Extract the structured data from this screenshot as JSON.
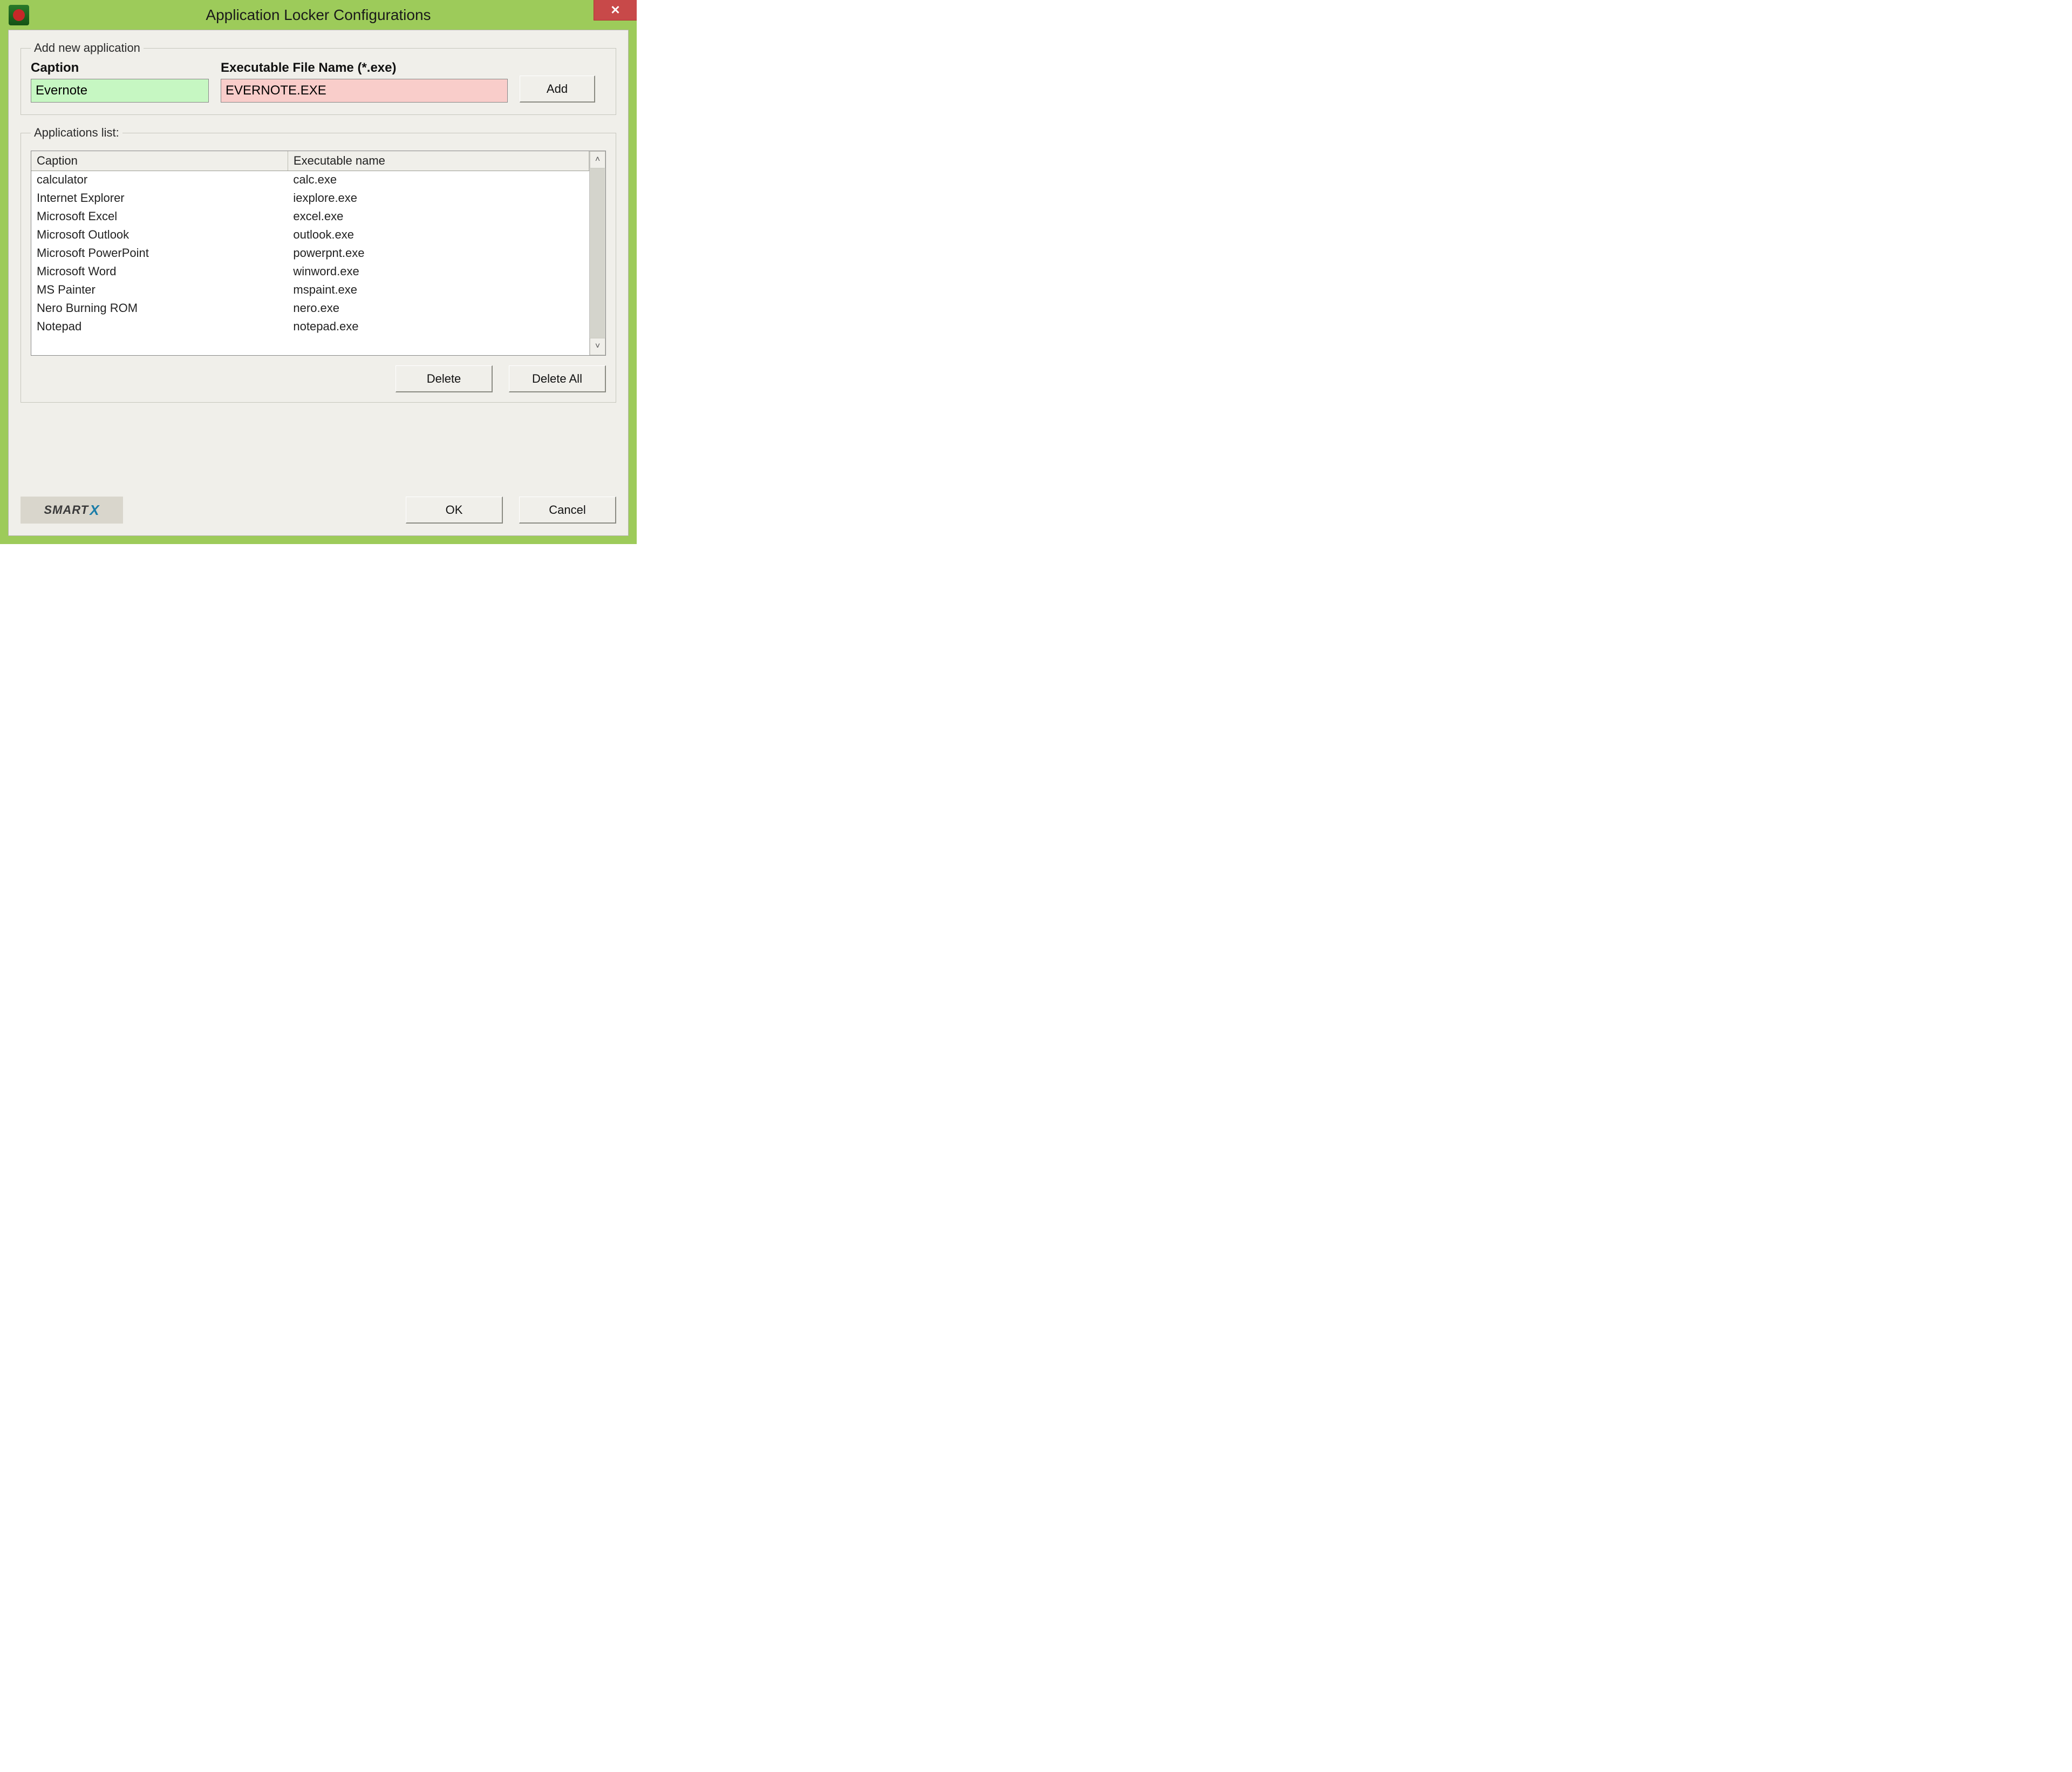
{
  "window": {
    "title": "Application Locker Configurations",
    "close_glyph": "✕"
  },
  "add_group": {
    "legend": "Add new application",
    "caption_label": "Caption",
    "caption_value": "Evernote",
    "exe_label": "Executable File Name (*.exe)",
    "exe_value": "EVERNOTE.EXE",
    "add_button": "Add"
  },
  "list_group": {
    "legend": "Applications list:",
    "columns": {
      "caption": "Caption",
      "exe": "Executable name"
    },
    "rows": [
      {
        "caption": "calculator",
        "exe": "calc.exe"
      },
      {
        "caption": "Internet Explorer",
        "exe": "iexplore.exe"
      },
      {
        "caption": "Microsoft Excel",
        "exe": "excel.exe"
      },
      {
        "caption": "Microsoft Outlook",
        "exe": "outlook.exe"
      },
      {
        "caption": "Microsoft PowerPoint",
        "exe": "powerpnt.exe"
      },
      {
        "caption": "Microsoft Word",
        "exe": "winword.exe"
      },
      {
        "caption": "MS Painter",
        "exe": "mspaint.exe"
      },
      {
        "caption": "Nero Burning ROM",
        "exe": "nero.exe"
      },
      {
        "caption": "Notepad",
        "exe": "notepad.exe"
      }
    ],
    "delete_button": "Delete",
    "delete_all_button": "Delete All",
    "scroll_up_glyph": "˄",
    "scroll_down_glyph": "˅"
  },
  "footer": {
    "logo_part1": "SMART",
    "logo_part2": "X",
    "ok_button": "OK",
    "cancel_button": "Cancel"
  }
}
